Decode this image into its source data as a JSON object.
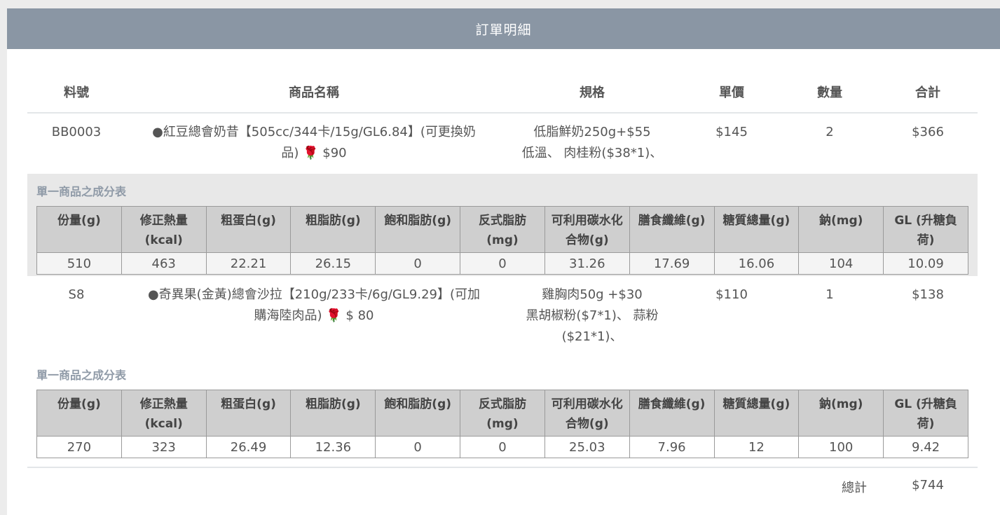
{
  "header": {
    "title": "訂單明細"
  },
  "columns": [
    "料號",
    "商品名稱",
    "規格",
    "單價",
    "數量",
    "合計"
  ],
  "nutrition_headers": [
    "份量(g)",
    "修正熱量(kcal)",
    "粗蛋白(g)",
    "粗脂肪(g)",
    "飽和脂肪(g)",
    "反式脂肪(mg)",
    "可利用碳水化合物(g)",
    "膳食纖維(g)",
    "糖質總量(g)",
    "鈉(mg)",
    "GL (升糖負荷)"
  ],
  "nutrition_title": "單一商品之成分表",
  "items": [
    {
      "sku": "BB0003",
      "name_line1": "●紅豆總會奶昔【505cc/344卡/15g/GL6.84】(可更換奶",
      "name_line2_prefix": "品)",
      "name_line2_price": "$90",
      "spec_line1": "低脂鮮奶250g+$55",
      "spec_line2": "低溫、 肉桂粉($38*1)、",
      "spec_line3": "",
      "unit_price": "$145",
      "qty": "2",
      "subtotal": "$366",
      "nutrition": [
        "510",
        "463",
        "22.21",
        "26.15",
        "0",
        "0",
        "31.26",
        "17.69",
        "16.06",
        "104",
        "10.09"
      ]
    },
    {
      "sku": "S8",
      "name_line1": "●奇異果(金黃)總會沙拉【210g/233卡/6g/GL9.29】(可加",
      "name_line2_prefix": "購海陸肉品)",
      "name_line2_price": "$ 80",
      "spec_line1": "雞胸肉50g +$30",
      "spec_line2": "黑胡椒粉($7*1)、 蒜粉",
      "spec_line3": "($21*1)、",
      "unit_price": "$110",
      "qty": "1",
      "subtotal": "$138",
      "nutrition": [
        "270",
        "323",
        "26.49",
        "12.36",
        "0",
        "0",
        "25.03",
        "7.96",
        "12",
        "100",
        "9.42"
      ]
    }
  ],
  "total": {
    "label": "總計",
    "value": "$744"
  },
  "colors": {
    "header_bg": "#8a96a4",
    "subsection_bg": "#e8e8e8",
    "table_header_bg": "#cfcfcf"
  },
  "icons": {
    "rose": "rose-icon"
  }
}
